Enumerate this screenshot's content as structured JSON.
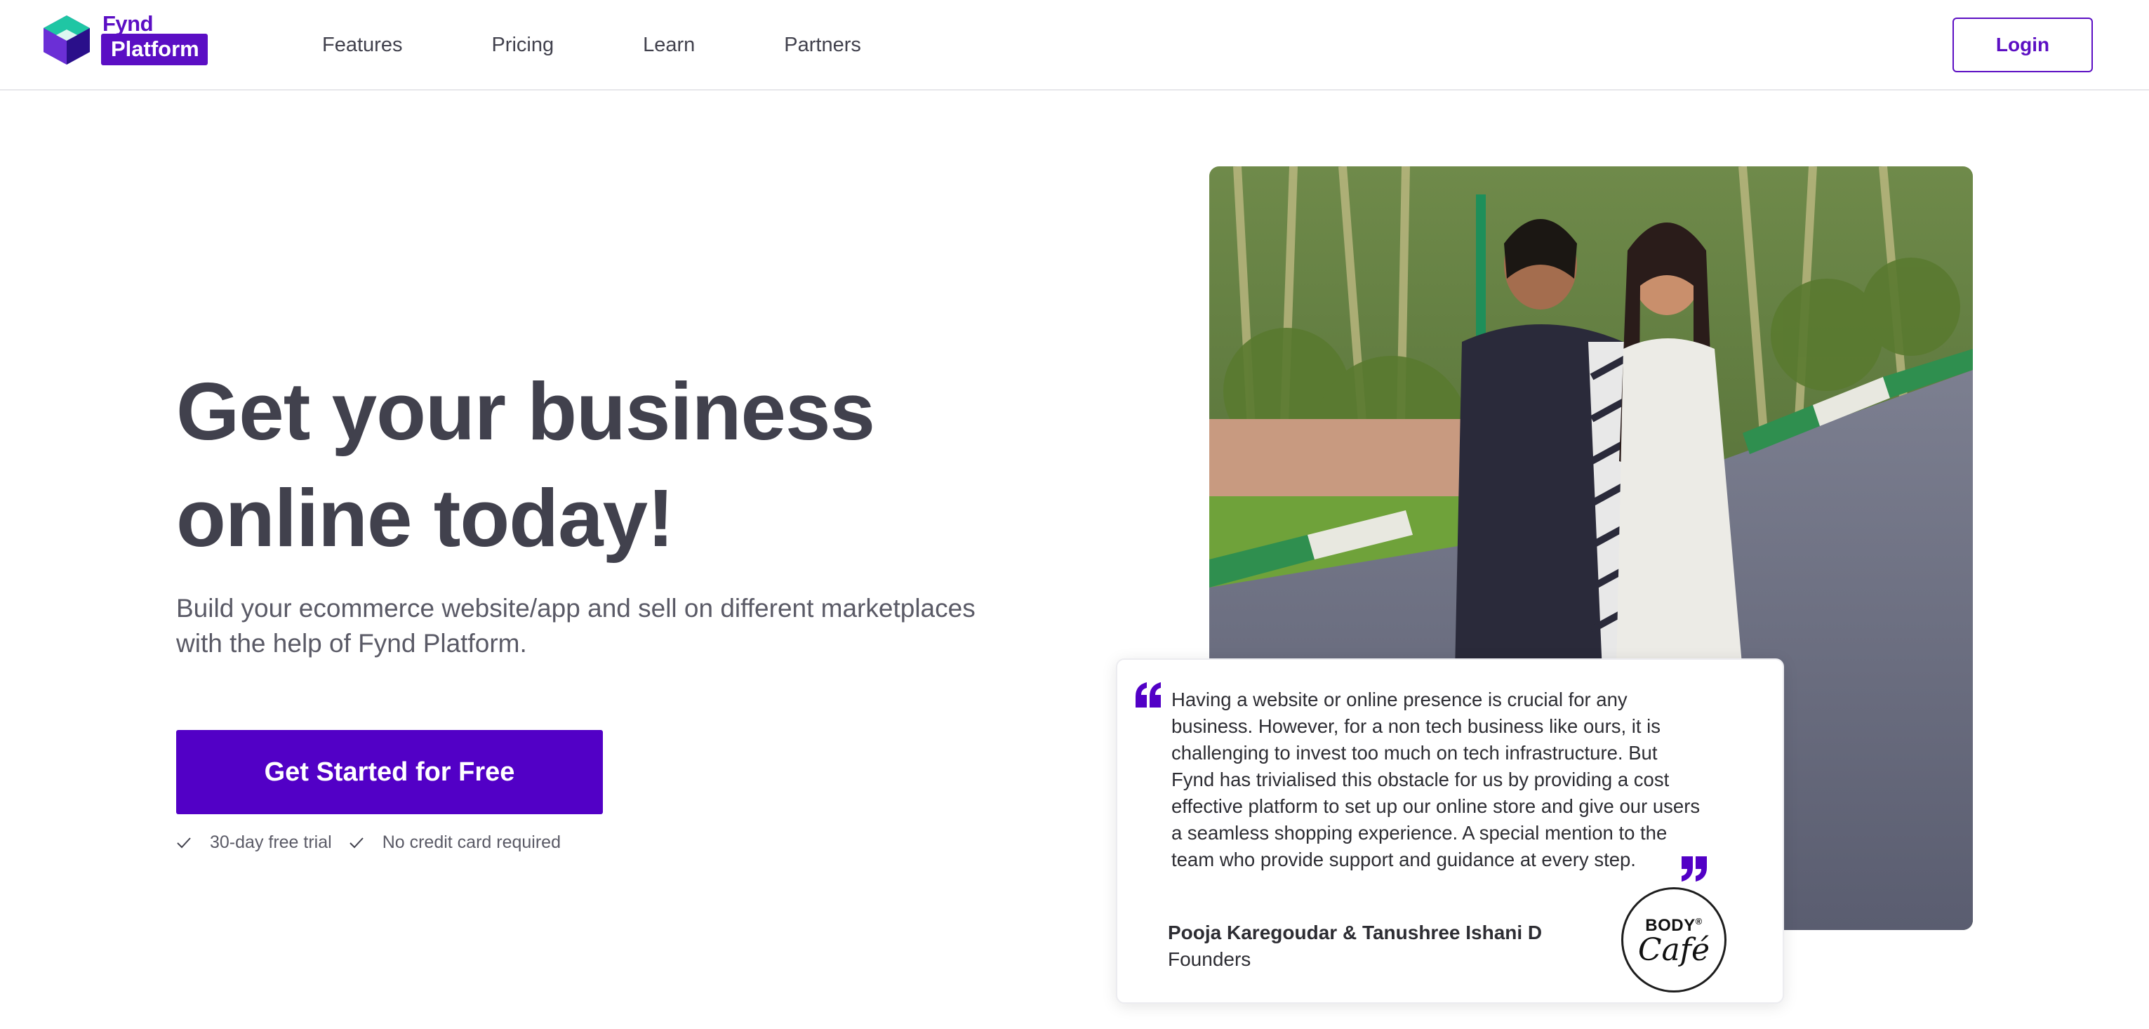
{
  "header": {
    "logo": {
      "brand": "Fynd",
      "product": "Platform",
      "icon": "fynd-logo-icon"
    },
    "nav": [
      "Features",
      "Pricing",
      "Learn",
      "Partners"
    ],
    "login_label": "Login"
  },
  "hero": {
    "headline_line1": "Get your business",
    "headline_line2": "online today!",
    "subtitle_line1": "Build your ecommerce website/app and sell on different marketplaces",
    "subtitle_line2": "with the help of Fynd Platform.",
    "cta_label": "Get Started for Free",
    "features": [
      "30-day free trial",
      "No credit card required"
    ],
    "feature_icon": "check-icon"
  },
  "testimonial": {
    "lines": [
      "Having a website or online presence is crucial for any",
      "business. However, for a non tech business like ours, it is",
      "challenging to invest too much on tech infrastructure. But",
      "Fynd has trivialised this obstacle for us by providing a cost",
      "effective platform to set up our online store and give our users",
      "a seamless shopping experience. A special mention to the",
      "team who provide support and guidance at every step."
    ],
    "author": "Pooja Karegoudar & Tanushree Ishani D",
    "role": "Founders",
    "badge_top": "BODY",
    "badge_bottom": "Café",
    "badge_mark": "®"
  },
  "colors": {
    "brand": "#5200c6",
    "text": "#41414d",
    "muted": "#5a5a66"
  }
}
